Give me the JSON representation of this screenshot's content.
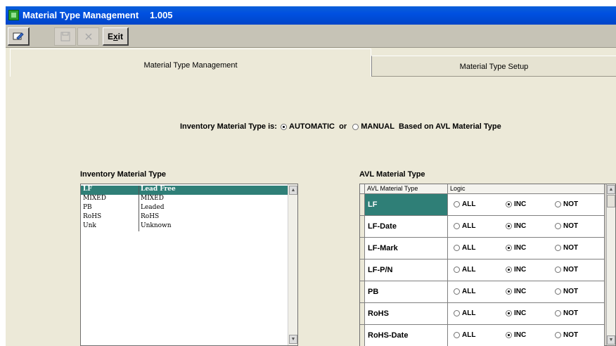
{
  "window": {
    "title": "Material Type Management",
    "version": "1.005"
  },
  "toolbar": {
    "exit_prefix": "E",
    "exit_hotkey": "x",
    "exit_suffix": "it"
  },
  "tabs": [
    {
      "label": "Material Type Management",
      "active": true
    },
    {
      "label": "Material Type Setup",
      "active": false
    }
  ],
  "settings": {
    "prefix": "Inventory Material Type is:",
    "option_automatic": "AUTOMATIC",
    "connector": "or",
    "option_manual": "MANUAL",
    "suffix": "Based on AVL Material Type",
    "selected": "AUTOMATIC"
  },
  "inventory": {
    "title": "Inventory Material Type",
    "items": [
      {
        "code": "LF",
        "name": "Lead Free",
        "selected": true
      },
      {
        "code": "MIXED",
        "name": "MIXED",
        "selected": false
      },
      {
        "code": "PB",
        "name": "Leaded",
        "selected": false
      },
      {
        "code": "RoHS",
        "name": "RoHS",
        "selected": false
      },
      {
        "code": "Unk",
        "name": "Unknown",
        "selected": false
      }
    ]
  },
  "avl": {
    "title": "AVL Material Type",
    "col_type": "AVL Material Type",
    "col_logic": "Logic",
    "options": [
      "ALL",
      "INC",
      "NOT"
    ],
    "rows": [
      {
        "name": "LF",
        "logic": "INC",
        "selected": true
      },
      {
        "name": "LF-Date",
        "logic": "INC",
        "selected": false
      },
      {
        "name": "LF-Mark",
        "logic": "INC",
        "selected": false
      },
      {
        "name": "LF-P/N",
        "logic": "INC",
        "selected": false
      },
      {
        "name": "PB",
        "logic": "INC",
        "selected": false
      },
      {
        "name": "RoHS",
        "logic": "INC",
        "selected": false
      },
      {
        "name": "RoHS-Date",
        "logic": "INC",
        "selected": false
      }
    ]
  },
  "colors": {
    "selection": "#2f7f77",
    "titlebar": "#0050e0",
    "face": "#ece9d8"
  }
}
